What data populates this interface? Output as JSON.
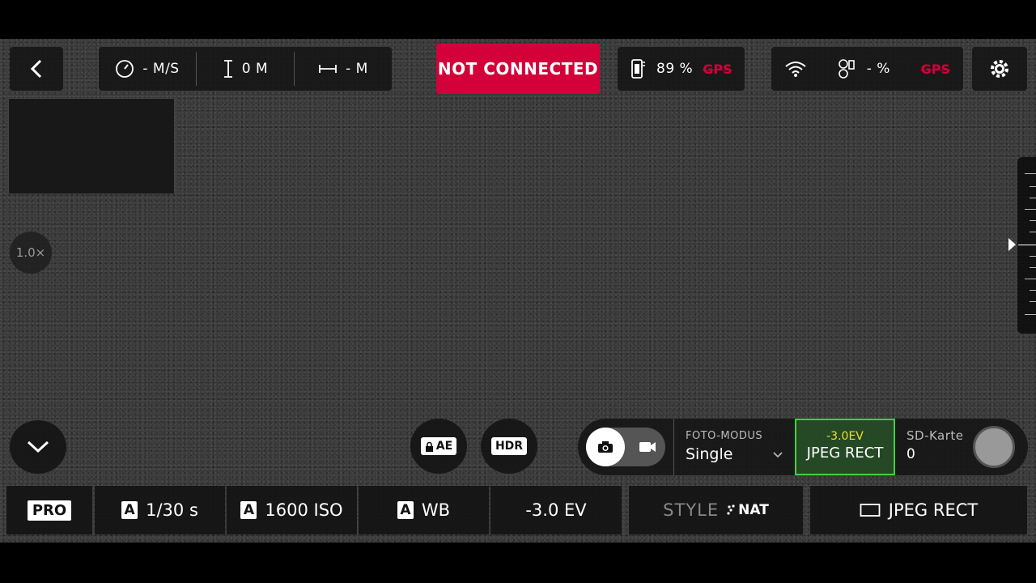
{
  "topbar": {
    "speed": "- M/S",
    "height": "0 M",
    "distance": "- M",
    "status": "NOT CONNECTED",
    "phone_battery": "89 %",
    "phone_gps": "GPS",
    "drone_battery": "- %",
    "drone_gps": "GPS"
  },
  "viewer": {
    "zoom": "1.0×"
  },
  "controls": {
    "ae_lock": "AE",
    "hdr": "HDR",
    "foto_modus_caption": "FOTO-MODUS",
    "foto_modus_value": "Single",
    "ev_preview": "-3.0EV",
    "format_preview": "JPEG RECT",
    "sd_caption": "SD-Karte",
    "sd_value": "0"
  },
  "params": {
    "pro": "PRO",
    "auto_badge": "A",
    "shutter": "1/30 s",
    "iso": "1600 ISO",
    "wb": "WB",
    "ev": "-3.0 EV",
    "style_label": "STYLE",
    "style_value": "NAT",
    "format": "JPEG RECT"
  },
  "colors": {
    "alert": "#d4003a",
    "highlight_green": "#3fd23f",
    "ev_yellow": "#f0e030"
  }
}
